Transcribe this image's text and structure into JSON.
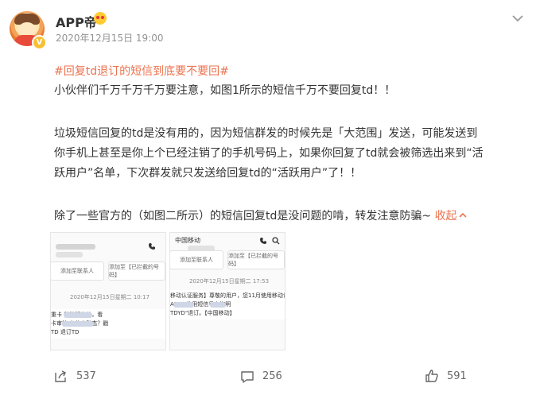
{
  "post": {
    "username": "APP帝",
    "timestamp": "2020年12月15日 19:00",
    "hashtag": "#回复td退订的短信到底要不要回#",
    "lines": [
      "小伙伴们千万千万千万要注意，如图1所示的短信千万不要回复td！！",
      "垃圾短信回复的td是没有用的，因为短信群发的时候先是「大范围」发送，可能发送到",
      "你手机上甚至是你上个已经注销了的手机号码上，如果你回复了td就会被筛选出来到“活",
      "跃用户”名单，下次群发就只发送给回复td的“活跃用户”了！！",
      "除了一些官方的（如图二所示）的短信回复td是没问题的啃，转发注意防骗~ "
    ],
    "collapse_label": "收起",
    "collapse_arrow": "^"
  },
  "thumb1": {
    "btn_left": "添加至联系人",
    "btn_right": "添加至【已拦截的号码】",
    "date": "2020年12月15日星期二 10:17",
    "msg_line1": "重卡               移除解出护，看",
    "msg_line2": "卡审核              有什么动态？戳",
    "msg_line3": "TD 退订TD"
  },
  "thumb2": {
    "carrier": "中国移动",
    "btn_left": "添加至联系人",
    "btn_right": "添加至【已拦截的号码】",
    "date": "2020年12月15日星期二 17:53",
    "msg_line1": "移动认证服务】尊敬的用户，您11月使用移动认",
    "msg_line2": "APP，使用短信号查询明",
    "msg_line3": "TDYD\"退订。【中国移动】"
  },
  "footer": {
    "repost_count": "537",
    "comment_count": "256",
    "like_count": "591"
  },
  "icons": {
    "more": "chevron-down-icon",
    "repost": "share-icon",
    "comment": "comment-icon",
    "like": "thumbs-up-icon",
    "verified": "v-badge-icon"
  },
  "colors": {
    "accent": "#eb7350",
    "verified": "#f7c034",
    "timestamp": "#939393"
  }
}
